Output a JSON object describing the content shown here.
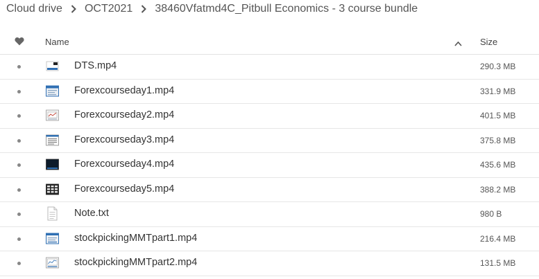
{
  "breadcrumb": {
    "items": [
      "Cloud drive",
      "OCT2021",
      "38460Vfatmd4C_Pitbull Economics - 3 course bundle"
    ]
  },
  "header": {
    "name_label": "Name",
    "size_label": "Size",
    "sort_direction": "ascending"
  },
  "files": [
    {
      "name": "DTS.mp4",
      "size": "290.3 MB",
      "thumb": "video-thumb-small-screen"
    },
    {
      "name": "Forexcourseday1.mp4",
      "size": "331.9 MB",
      "thumb": "video-thumb-blue-header"
    },
    {
      "name": "Forexcourseday2.mp4",
      "size": "401.5 MB",
      "thumb": "video-thumb-chart"
    },
    {
      "name": "Forexcourseday3.mp4",
      "size": "375.8 MB",
      "thumb": "video-thumb-document"
    },
    {
      "name": "Forexcourseday4.mp4",
      "size": "435.6 MB",
      "thumb": "video-thumb-dark-screen"
    },
    {
      "name": "Forexcourseday5.mp4",
      "size": "388.2 MB",
      "thumb": "video-thumb-grid"
    },
    {
      "name": "Note.txt",
      "size": "980 B",
      "thumb": "text-file-icon"
    },
    {
      "name": "stockpickingMMTpart1.mp4",
      "size": "216.4 MB",
      "thumb": "video-thumb-blue-header"
    },
    {
      "name": "stockpickingMMTpart2.mp4",
      "size": "131.5 MB",
      "thumb": "video-thumb-chart"
    }
  ],
  "colors": {
    "text": "#333333",
    "muted": "#555555",
    "divider": "#e6e6e6",
    "thumb_blue": "#2f6fb3"
  }
}
